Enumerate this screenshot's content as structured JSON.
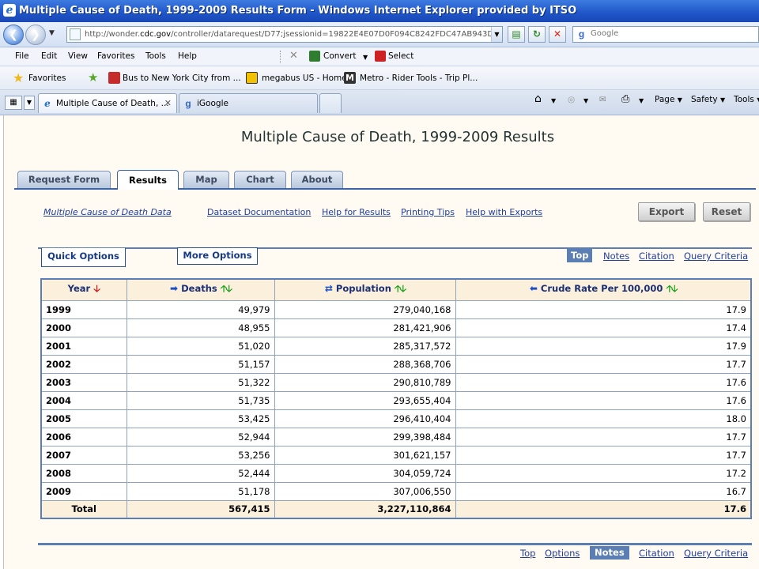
{
  "window": {
    "title": "Multiple Cause of Death, 1999-2009 Results Form - Windows Internet Explorer provided by ITSO"
  },
  "address_bar": {
    "url_prefix": "http://wonder.",
    "url_domain": "cdc.gov",
    "url_rest": "/controller/datarequest/D77;jsessionid=19822E4E07D0F094C8242FDC47AB943D",
    "search_placeholder": "Google"
  },
  "menu": {
    "items": [
      "File",
      "Edit",
      "View",
      "Favorites",
      "Tools",
      "Help"
    ],
    "convert_label": "Convert",
    "select_label": "Select"
  },
  "favorites": {
    "label": "Favorites",
    "links": [
      "Bus to New York City from ...",
      "megabus US - Home",
      "Metro - Rider Tools - Trip Pl..."
    ]
  },
  "browser_tabs": [
    {
      "label": "Multiple Cause of Death, ...",
      "active": true
    },
    {
      "label": "iGoogle",
      "active": false
    }
  ],
  "command_bar": {
    "page": "Page",
    "safety": "Safety",
    "tools": "Tools"
  },
  "page": {
    "title": "Multiple Cause of Death, 1999-2009 Results",
    "tabs": [
      "Request Form",
      "Results",
      "Map",
      "Chart",
      "About"
    ],
    "active_tab": "Results",
    "links": {
      "data": "Multiple Cause of Death Data",
      "docs": "Dataset Documentation",
      "help_results": "Help for Results",
      "printing": "Printing Tips",
      "help_exports": "Help with Exports"
    },
    "buttons": {
      "export": "Export",
      "reset": "Reset"
    },
    "options": {
      "quick": "Quick Options",
      "more": "More Options"
    },
    "top_nav": {
      "top": "Top",
      "notes": "Notes",
      "citation": "Citation",
      "query": "Query Criteria"
    },
    "bottom_nav": {
      "top": "Top",
      "options": "Options",
      "notes": "Notes",
      "citation": "Citation",
      "query": "Query Criteria"
    }
  },
  "table": {
    "headers": [
      "Year",
      "Deaths",
      "Population",
      "Crude Rate Per 100,000"
    ],
    "rows": [
      [
        "1999",
        "49,979",
        "279,040,168",
        "17.9"
      ],
      [
        "2000",
        "48,955",
        "281,421,906",
        "17.4"
      ],
      [
        "2001",
        "51,020",
        "285,317,572",
        "17.9"
      ],
      [
        "2002",
        "51,157",
        "288,368,706",
        "17.7"
      ],
      [
        "2003",
        "51,322",
        "290,810,789",
        "17.6"
      ],
      [
        "2004",
        "51,735",
        "293,655,404",
        "17.6"
      ],
      [
        "2005",
        "53,425",
        "296,410,404",
        "18.0"
      ],
      [
        "2006",
        "52,944",
        "299,398,484",
        "17.7"
      ],
      [
        "2007",
        "53,256",
        "301,621,157",
        "17.7"
      ],
      [
        "2008",
        "52,444",
        "304,059,724",
        "17.2"
      ],
      [
        "2009",
        "51,178",
        "307,006,550",
        "16.7"
      ]
    ],
    "total": [
      "Total",
      "567,415",
      "3,227,110,864",
      "17.6"
    ]
  },
  "colors": {
    "accent": "#5b7fb4",
    "header_bg": "#fbf0dc",
    "link": "#203f9a"
  }
}
